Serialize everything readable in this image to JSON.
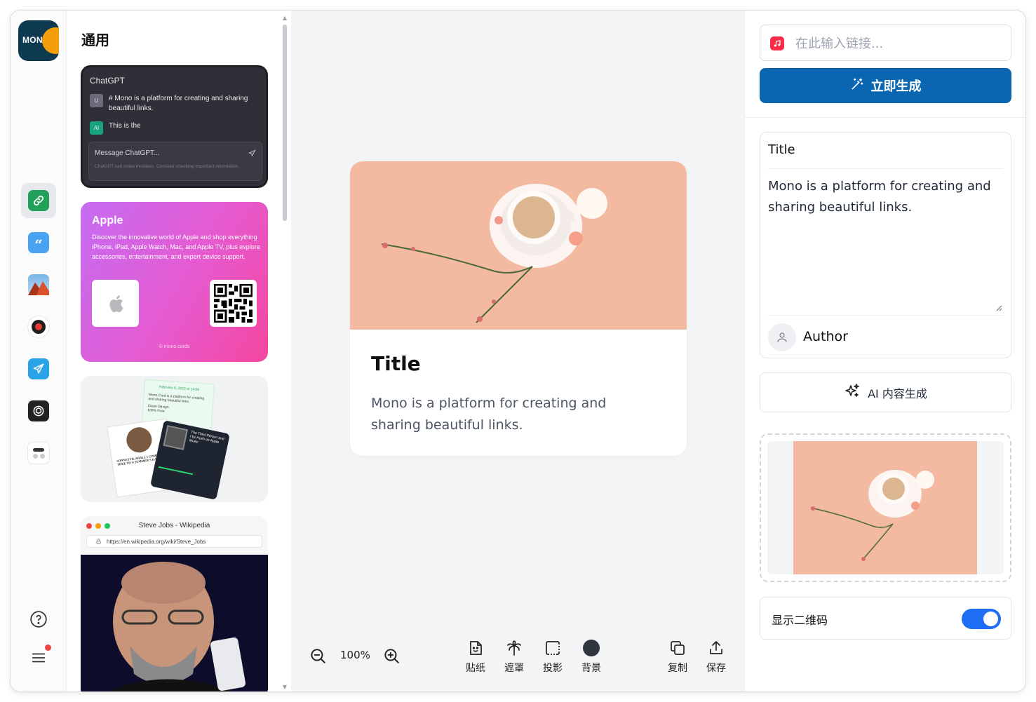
{
  "rail": {
    "logo_text": "MON",
    "items": [
      {
        "id": "link",
        "icon": "link-icon",
        "color": "#22a05a",
        "active": true
      },
      {
        "id": "quote",
        "icon": "quote-icon",
        "color": "#4aa3f0",
        "active": false
      },
      {
        "id": "mountain",
        "icon": "mountain-icon",
        "color": "#d9532c",
        "active": false
      },
      {
        "id": "record",
        "icon": "record-icon",
        "color": "#1f1f1f",
        "active": false
      },
      {
        "id": "telegram",
        "icon": "telegram-icon",
        "color": "#2aa3e8",
        "active": false
      },
      {
        "id": "chatgpt",
        "icon": "chatgpt-icon",
        "color": "#222222",
        "active": false
      },
      {
        "id": "widget",
        "icon": "widget-icon",
        "color": "#333333",
        "active": false
      }
    ],
    "help_icon": "help-icon",
    "menu_icon": "menu-icon"
  },
  "templates": {
    "heading": "通用",
    "chatgpt": {
      "name": "ChatGPT",
      "user_badge": "U",
      "user_msg": "# Mono is a platform for creating and sharing beautiful links.",
      "ai_badge": "AI",
      "ai_msg": "This is the",
      "input_placeholder": "Message ChatGPT...",
      "note": "ChatGPT can make mistakes. Consider checking important information."
    },
    "apple": {
      "name": "Apple",
      "description": "Discover the innovative world of Apple and shop everything iPhone, iPad, Apple Watch, Mac, and Apple TV, plus explore accessories, entertainment, and expert device support.",
      "footer": "© mono.cards"
    },
    "collage": {
      "note_date": "February 6, 2023 at 14:06",
      "note_text": "Mono Card is a platform for creating and sharing beautiful links.",
      "note_items": [
        "Clean Design",
        "100% Free"
      ],
      "music_title": "The Third Person and I by Hush on Apple Music",
      "sonnet": "SONNET III. SHALL I COMPARE THEE TO A SUMMER'S DAY"
    },
    "wiki": {
      "title": "Steve Jobs - Wikipedia",
      "url": "https://en.wikipedia.org/wiki/Steve_Jobs"
    }
  },
  "preview": {
    "title": "Title",
    "description": "Mono is a platform for creating and sharing beautiful links."
  },
  "toolbar": {
    "zoom": "100%",
    "tools": [
      {
        "id": "sticker",
        "label": "贴纸",
        "icon": "sticker-icon"
      },
      {
        "id": "mask",
        "label": "遮罩",
        "icon": "palm-tree-icon"
      },
      {
        "id": "shadow",
        "label": "投影",
        "icon": "shadow-icon"
      },
      {
        "id": "background",
        "label": "背景",
        "icon": "color-dot-icon",
        "color": "#2f3640"
      },
      {
        "id": "copy",
        "label": "复制",
        "icon": "copy-icon"
      },
      {
        "id": "save",
        "label": "保存",
        "icon": "share-icon"
      }
    ]
  },
  "panel": {
    "url_placeholder": "在此输入链接...",
    "generate_label": "立即生成",
    "title_value": "Title",
    "description_value": "Mono is a platform for creating and sharing beautiful links.",
    "author_value": "Author",
    "ai_label": "AI 内容生成",
    "qr_label": "显示二维码",
    "qr_enabled": true,
    "accent": "#0a66b0",
    "toggle_color": "#1d6ef5"
  }
}
